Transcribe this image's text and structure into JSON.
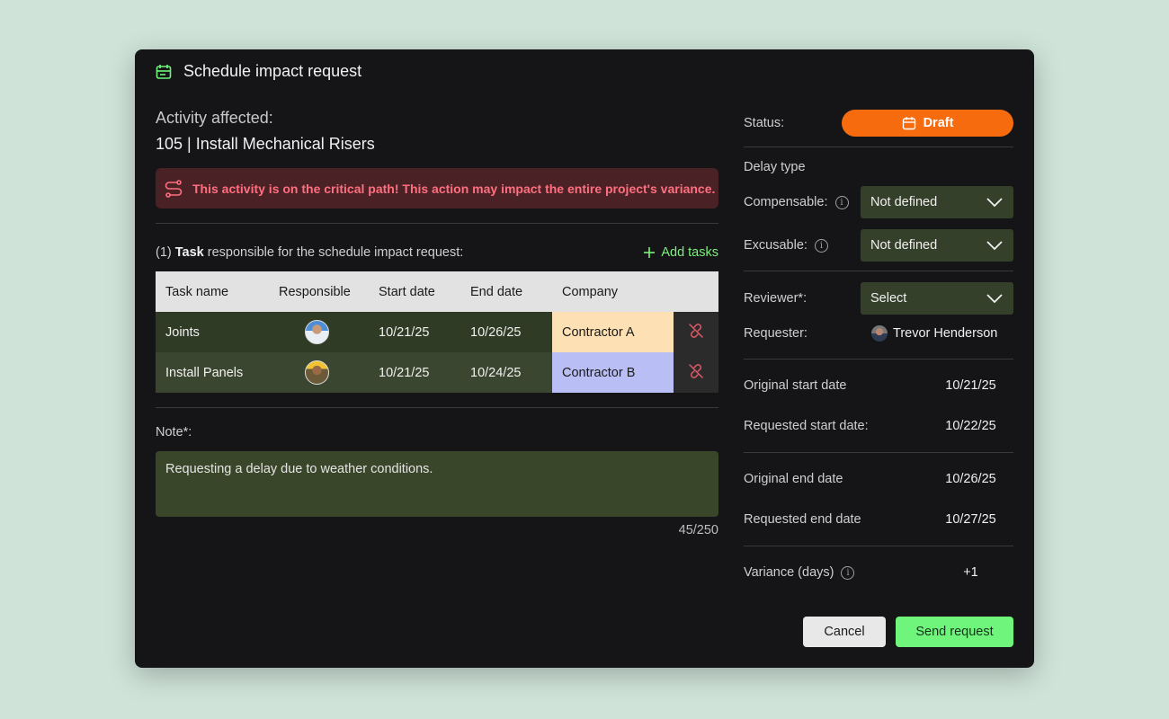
{
  "modal": {
    "title": "Schedule impact request"
  },
  "activity": {
    "label": "Activity affected:",
    "value": "105 | Install Mechanical Risers"
  },
  "alert": {
    "text": "This activity is on the critical path! This action may impact the entire project's variance."
  },
  "tasks": {
    "heading_prefix": "(1)",
    "heading_bold": "Task",
    "heading_rest": "responsible for the schedule impact request:",
    "add_label": "Add tasks",
    "columns": [
      "Task name",
      "Responsible",
      "Start date",
      "End date",
      "Company"
    ],
    "rows": [
      {
        "name": "Joints",
        "start": "10/21/25",
        "end": "10/26/25",
        "company": "Contractor A",
        "company_color": "#fde0b3"
      },
      {
        "name": "Install Panels",
        "start": "10/21/25",
        "end": "10/24/25",
        "company": "Contractor B",
        "company_color": "#b9bff4"
      }
    ]
  },
  "note": {
    "label": "Note*:",
    "value": "Requesting a delay due to weather conditions.",
    "count": "45/250"
  },
  "status": {
    "label": "Status:",
    "value": "Draft",
    "color": "#f76b0f"
  },
  "delay": {
    "heading": "Delay type",
    "compensable_label": "Compensable:",
    "compensable_value": "Not defined",
    "excusable_label": "Excusable:",
    "excusable_value": "Not defined"
  },
  "reviewer": {
    "label": "Reviewer*:",
    "value": "Select"
  },
  "requester": {
    "label": "Requester:",
    "name": "Trevor Henderson"
  },
  "dates": {
    "orig_start_label": "Original start date",
    "orig_start": "10/21/25",
    "req_start_label": "Requested start date:",
    "req_start": "10/22/25",
    "orig_end_label": "Original end date",
    "orig_end": "10/26/25",
    "req_end_label": "Requested end date",
    "req_end": "10/27/25"
  },
  "variance": {
    "label": "Variance (days)",
    "value": "+1"
  },
  "buttons": {
    "cancel": "Cancel",
    "send": "Send request"
  },
  "colors": {
    "accent_green": "#6ff57b",
    "alert_red": "#ff6f7f",
    "panel_bg": "#151517"
  }
}
